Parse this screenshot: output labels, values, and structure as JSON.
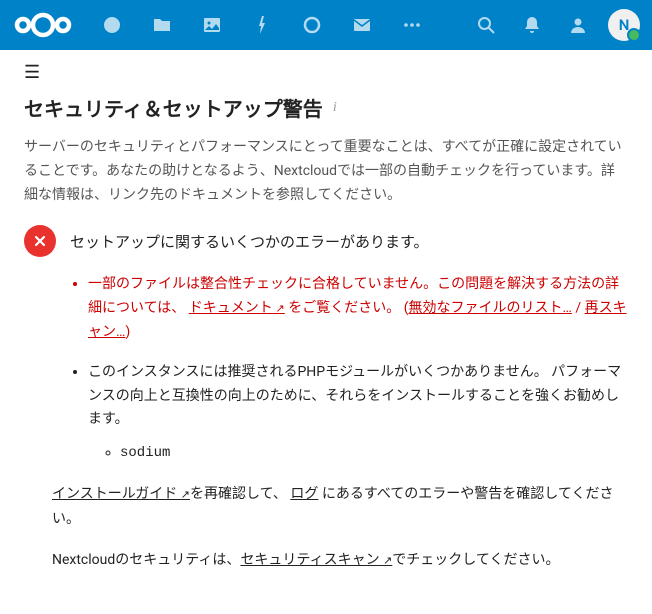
{
  "topbar": {
    "avatar_initial": "N"
  },
  "page": {
    "title": "セキュリティ＆セットアップ警告",
    "intro": "サーバーのセキュリティとパフォーマンスにとって重要なことは、すべてが正確に設定されていることです。あなたの助けとなるよう、Nextcloudでは一部の自動チェックを行っています。詳細な情報は、リンク先のドキュメントを参照してください。",
    "error_heading": "セットアップに関するいくつかのエラーがあります。",
    "issue1_pre": "一部のファイルは整合性チェックに合格していません。この問題を解決する方法の詳細については、",
    "issue1_doc": "ドキュメント",
    "issue1_mid": "をご覧ください。 (",
    "issue1_link1": "無効なファイルのリスト…",
    "issue1_sep": " / ",
    "issue1_link2": "再スキャン…",
    "issue1_end": ")",
    "issue2": "このインスタンスには推奨されるPHPモジュールがいくつかありません。 パフォーマンスの向上と互換性の向上のために、それらをインストールすることを強くお勧めします。",
    "missing_module": "sodium",
    "footer1_link1": "インストールガイド ",
    "footer1_mid": "を再確認して、 ",
    "footer1_link2": "ログ",
    "footer1_end": " にあるすべてのエラーや警告を確認してください。",
    "footer2_pre": "Nextcloudのセキュリティは、",
    "footer2_link": "セキュリティスキャン ",
    "footer2_end": "でチェックしてください。"
  }
}
